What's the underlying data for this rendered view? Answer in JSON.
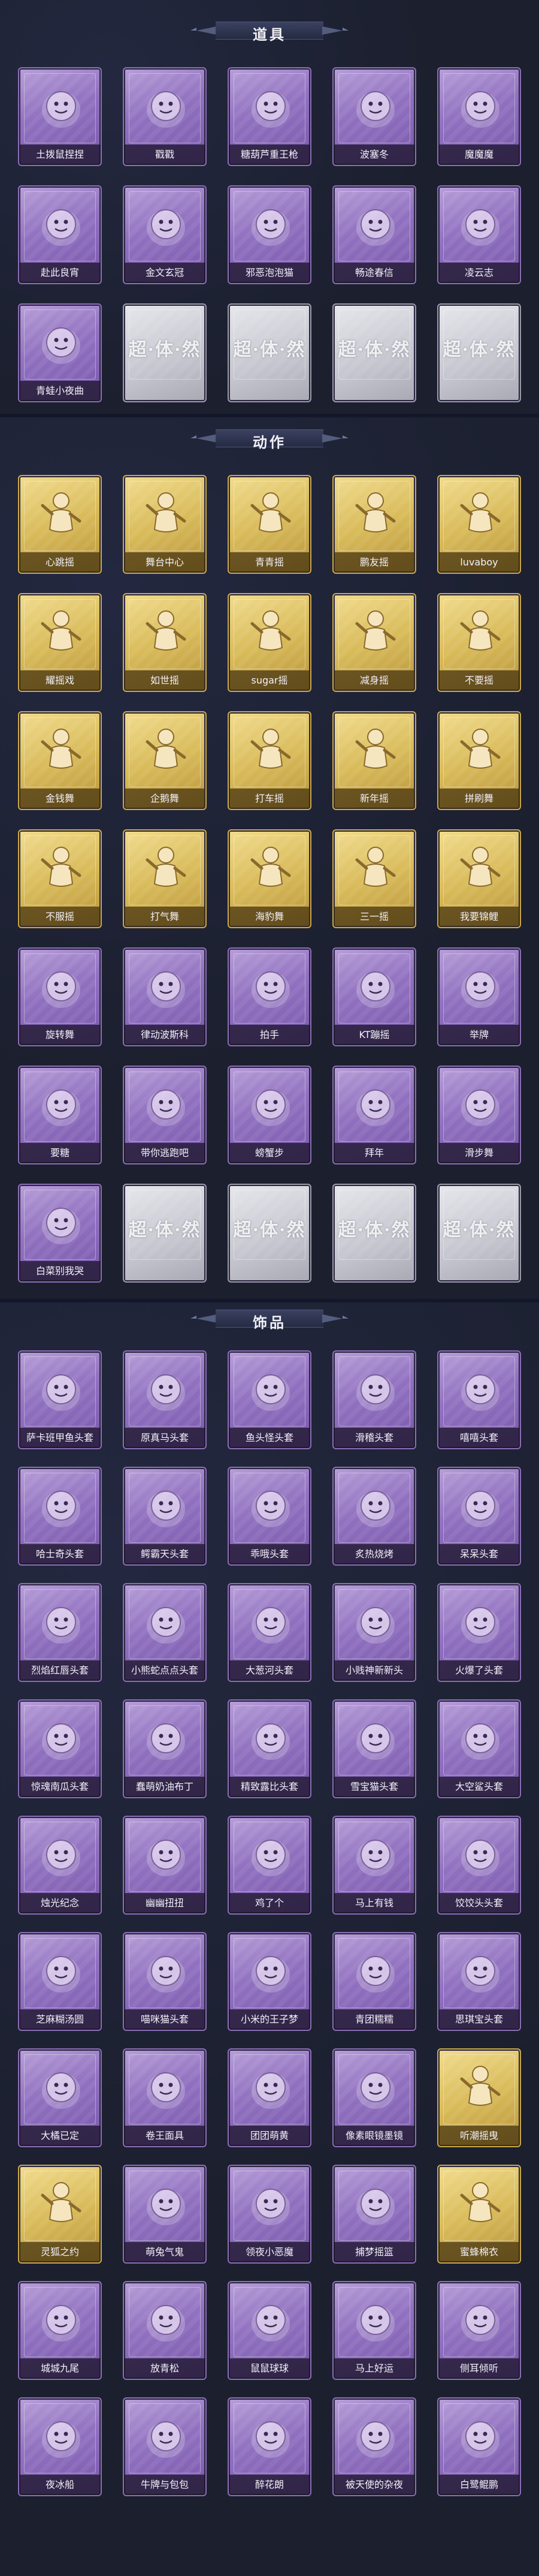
{
  "sections": [
    {
      "title": "道具",
      "items": [
        {
          "label": "土拨鼠捏捏",
          "kind": "item",
          "icon": "groundhog-doll-icon"
        },
        {
          "label": "戳戳",
          "kind": "item",
          "icon": "staff-icon"
        },
        {
          "label": "糖葫芦重王枪",
          "kind": "item",
          "icon": "candy-spear-icon"
        },
        {
          "label": "波塞冬",
          "kind": "item",
          "icon": "trident-icon"
        },
        {
          "label": "魔魔魔",
          "kind": "item",
          "icon": "magic-girl-icon"
        },
        {
          "label": "赴此良宵",
          "kind": "item",
          "icon": "lantern-icon"
        },
        {
          "label": "金文玄冠",
          "kind": "item",
          "icon": "jade-bottle-icon"
        },
        {
          "label": "邪恶泡泡猫",
          "kind": "item",
          "icon": "bubble-cat-icon"
        },
        {
          "label": "畅途春信",
          "kind": "item",
          "icon": "fan-icon"
        },
        {
          "label": "凌云志",
          "kind": "item",
          "icon": "winged-sword-icon"
        },
        {
          "label": "青蛙小夜曲",
          "kind": "item",
          "icon": "frog-icon"
        },
        {
          "label": "",
          "kind": "empty",
          "icon": "placeholder-logo"
        },
        {
          "label": "",
          "kind": "empty",
          "icon": "placeholder-logo"
        },
        {
          "label": "",
          "kind": "empty",
          "icon": "placeholder-logo"
        },
        {
          "label": "",
          "kind": "empty",
          "icon": "placeholder-logo"
        }
      ]
    },
    {
      "title": "动作",
      "items": [
        {
          "label": "心跳摇",
          "kind": "gold",
          "icon": "dance-pose-icon"
        },
        {
          "label": "舞台中心",
          "kind": "gold",
          "icon": "dance-pose-icon"
        },
        {
          "label": "青青摇",
          "kind": "gold",
          "icon": "dance-pose-icon"
        },
        {
          "label": "鹏友摇",
          "kind": "gold",
          "icon": "dance-pose-icon"
        },
        {
          "label": "luvaboy",
          "kind": "gold",
          "icon": "dance-pose-icon"
        },
        {
          "label": "耀摇戏",
          "kind": "gold",
          "icon": "dance-pose-icon"
        },
        {
          "label": "如世摇",
          "kind": "gold",
          "icon": "dance-pose-icon"
        },
        {
          "label": "sugar摇",
          "kind": "gold",
          "icon": "dance-pose-icon"
        },
        {
          "label": "减身摇",
          "kind": "gold",
          "icon": "dance-pose-icon"
        },
        {
          "label": "不要摇",
          "kind": "gold",
          "icon": "dance-pose-icon"
        },
        {
          "label": "金钱舞",
          "kind": "gold",
          "icon": "dance-pose-icon"
        },
        {
          "label": "企鹅舞",
          "kind": "gold",
          "icon": "dance-pose-icon"
        },
        {
          "label": "打车摇",
          "kind": "gold",
          "icon": "dance-pose-icon"
        },
        {
          "label": "新年摇",
          "kind": "gold",
          "icon": "dance-pose-icon"
        },
        {
          "label": "拼刷舞",
          "kind": "gold",
          "icon": "dance-pose-icon"
        },
        {
          "label": "不服摇",
          "kind": "gold",
          "icon": "dance-pose-icon"
        },
        {
          "label": "打气舞",
          "kind": "gold",
          "icon": "dance-pose-icon"
        },
        {
          "label": "海豹舞",
          "kind": "gold",
          "icon": "dance-pose-icon"
        },
        {
          "label": "三一摇",
          "kind": "gold",
          "icon": "dance-pose-icon"
        },
        {
          "label": "我要锦鲤",
          "kind": "gold",
          "icon": "dance-pose-icon"
        },
        {
          "label": "旋转舞",
          "kind": "item",
          "icon": "dance-pose-icon"
        },
        {
          "label": "律动波斯科",
          "kind": "item",
          "icon": "dance-pose-icon"
        },
        {
          "label": "拍手",
          "kind": "item",
          "icon": "dance-pose-icon"
        },
        {
          "label": "KT蹦摇",
          "kind": "item",
          "icon": "dance-pose-icon"
        },
        {
          "label": "举牌",
          "kind": "item",
          "icon": "dance-pose-icon"
        },
        {
          "label": "要糖",
          "kind": "item",
          "icon": "dance-pose-icon"
        },
        {
          "label": "带你逃跑吧",
          "kind": "item",
          "icon": "dance-pose-icon"
        },
        {
          "label": "螃蟹步",
          "kind": "item",
          "icon": "dance-pose-icon"
        },
        {
          "label": "拜年",
          "kind": "item",
          "icon": "dance-pose-icon"
        },
        {
          "label": "滑步舞",
          "kind": "item",
          "icon": "dance-pose-icon"
        },
        {
          "label": "白菜别我哭",
          "kind": "item",
          "icon": "dance-pose-icon"
        },
        {
          "label": "",
          "kind": "empty",
          "icon": "placeholder-logo"
        },
        {
          "label": "",
          "kind": "empty",
          "icon": "placeholder-logo"
        },
        {
          "label": "",
          "kind": "empty",
          "icon": "placeholder-logo"
        },
        {
          "label": "",
          "kind": "empty",
          "icon": "placeholder-logo"
        }
      ]
    },
    {
      "title": "饰品",
      "items": [
        {
          "label": "萨卡班甲鱼头套",
          "kind": "item",
          "icon": "fish-head-icon"
        },
        {
          "label": "原真马头套",
          "kind": "item",
          "icon": "horse-head-icon"
        },
        {
          "label": "鱼头怪头套",
          "kind": "item",
          "icon": "frog-head-icon"
        },
        {
          "label": "滑稽头套",
          "kind": "item",
          "icon": "smiley-icon"
        },
        {
          "label": "嘻嘻头套",
          "kind": "item",
          "icon": "grin-emoji-icon"
        },
        {
          "label": "哈士奇头套",
          "kind": "item",
          "icon": "husky-head-icon"
        },
        {
          "label": "鳄霸天头套",
          "kind": "item",
          "icon": "croc-head-icon"
        },
        {
          "label": "乖哦头套",
          "kind": "item",
          "icon": "smiley-icon"
        },
        {
          "label": "炙热烧烤",
          "kind": "item",
          "icon": "bbq-head-icon"
        },
        {
          "label": "呆呆头套",
          "kind": "item",
          "icon": "smiley-icon"
        },
        {
          "label": "烈焰红唇头套",
          "kind": "item",
          "icon": "sunglasses-head-icon"
        },
        {
          "label": "小熊蛇点点头套",
          "kind": "item",
          "icon": "pet-head-icon"
        },
        {
          "label": "大葱河头套",
          "kind": "item",
          "icon": "onion-head-icon"
        },
        {
          "label": "小贱神新新头",
          "kind": "item",
          "icon": "bear-head-icon"
        },
        {
          "label": "火爆了头套",
          "kind": "item",
          "icon": "fire-head-icon"
        },
        {
          "label": "惊魂南瓜头套",
          "kind": "item",
          "icon": "pumpkin-head-icon"
        },
        {
          "label": "蠢萌奶油布丁",
          "kind": "item",
          "icon": "pudding-head-icon"
        },
        {
          "label": "精致露比头套",
          "kind": "item",
          "icon": "pink-bird-head-icon"
        },
        {
          "label": "雪宝猫头套",
          "kind": "item",
          "icon": "snow-cat-head-icon"
        },
        {
          "label": "大空鲨头套",
          "kind": "item",
          "icon": "shark-head-icon"
        },
        {
          "label": "烛光纪念",
          "kind": "item",
          "icon": "candle-icon"
        },
        {
          "label": "幽幽扭扭",
          "kind": "item",
          "icon": "dog-head-icon"
        },
        {
          "label": "鸡了个",
          "kind": "item",
          "icon": "bun-head-icon"
        },
        {
          "label": "马上有钱",
          "kind": "item",
          "icon": "pink-head-icon"
        },
        {
          "label": "饺饺头头套",
          "kind": "item",
          "icon": "dumpling-head-icon"
        },
        {
          "label": "芝麻糊汤圆",
          "kind": "item",
          "icon": "tangyuan-head-icon"
        },
        {
          "label": "喵咪猫头套",
          "kind": "item",
          "icon": "cat-head-icon"
        },
        {
          "label": "小米的王子梦",
          "kind": "item",
          "icon": "prince-head-icon"
        },
        {
          "label": "青团糯糯",
          "kind": "item",
          "icon": "green-bun-head-icon"
        },
        {
          "label": "思琪宝头套",
          "kind": "item",
          "icon": "egg-head-icon"
        },
        {
          "label": "大橘已定",
          "kind": "item",
          "icon": "orange-head-icon"
        },
        {
          "label": "卷王面具",
          "kind": "item",
          "icon": "mask-icon"
        },
        {
          "label": "团团萌黄",
          "kind": "item",
          "icon": "hamster-head-icon"
        },
        {
          "label": "像素眼镜墨镜",
          "kind": "item",
          "icon": "pixel-glasses-icon"
        },
        {
          "label": "听潮摇曳",
          "kind": "gold",
          "icon": "ghost-silhouette-icon"
        },
        {
          "label": "灵狐之约",
          "kind": "gold",
          "icon": "ghost-silhouette-icon"
        },
        {
          "label": "萌兔气鬼",
          "kind": "item",
          "icon": "ghost-silhouette-icon"
        },
        {
          "label": "领夜小恶魔",
          "kind": "item",
          "icon": "demon-head-icon"
        },
        {
          "label": "捕梦摇篮",
          "kind": "item",
          "icon": "ghost-silhouette-icon"
        },
        {
          "label": "蜜蜂棉衣",
          "kind": "gold",
          "icon": "bee-head-icon"
        },
        {
          "label": "城城九尾",
          "kind": "item",
          "icon": "fox-head-icon"
        },
        {
          "label": "放青松",
          "kind": "item",
          "icon": "bonsai-head-icon"
        },
        {
          "label": "鼠鼠球球",
          "kind": "item",
          "icon": "chick-head-icon"
        },
        {
          "label": "马上好运",
          "kind": "item",
          "icon": "horse-toy-icon"
        },
        {
          "label": "侧耳倾听",
          "kind": "item",
          "icon": "ear-icon"
        },
        {
          "label": "夜冰船",
          "kind": "item",
          "icon": "ice-icon"
        },
        {
          "label": "牛牌与包包",
          "kind": "item",
          "icon": "cow-head-icon"
        },
        {
          "label": "醉花朗",
          "kind": "item",
          "icon": "flower-head-icon"
        },
        {
          "label": "被天使的杂夜",
          "kind": "item",
          "icon": "girl-head-icon"
        },
        {
          "label": "白鹭鲲鹏",
          "kind": "item",
          "icon": "bird-head-icon"
        }
      ]
    }
  ],
  "placeholder_text": "超·体·然"
}
